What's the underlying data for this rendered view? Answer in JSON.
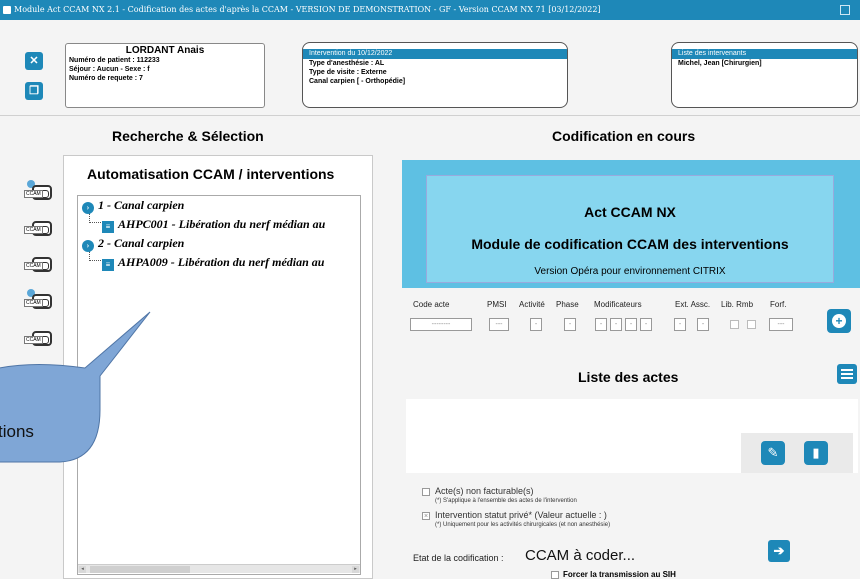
{
  "window": {
    "title": "Module Act CCAM NX 2.1 - Codification des actes d'après la CCAM - VERSION DE DEMONSTRATION - GF - Version CCAM NX 71 [03/12/2022]"
  },
  "patient": {
    "name": "LORDANT Anais",
    "patient_number": "Numéro de patient : 112233",
    "stay_sex": "Séjour : Aucun - Sexe : f",
    "request_number": "Numéro de requete : 7"
  },
  "intervention": {
    "header": "Intervention du 10/12/2022",
    "anesthesia": "Type d'anesthésie : AL",
    "visit": "Type de visite : Externe",
    "procedure": "Canal carpien [ - Orthopédie]"
  },
  "team": {
    "header": "Liste des intervenants",
    "member": "Michel, Jean [Chirurgien]"
  },
  "sections": {
    "search": "Recherche & Sélection",
    "coding": "Codification en cours",
    "automation": "Automatisation CCAM / interventions"
  },
  "side_icons": [
    {
      "name": "ccam-search-icon",
      "tag": "CCAM"
    },
    {
      "name": "ccam-folder-icon",
      "tag": "CCAM"
    },
    {
      "name": "ccam-list-icon",
      "tag": "CCAM"
    },
    {
      "name": "ccam-user-icon",
      "tag": "CCAM"
    },
    {
      "name": "ccam-team-icon",
      "tag": "CCAM"
    }
  ],
  "tree": {
    "nodes": [
      {
        "badge": "›",
        "label": "1 - Canal carpien"
      },
      {
        "badge": "≡",
        "label": "AHPC001 - Libération du nerf médian au"
      },
      {
        "badge": "›",
        "label": "2 - Canal carpien"
      },
      {
        "badge": "≡",
        "label": "AHPA009 - Libération du nerf médian au"
      }
    ]
  },
  "callout": {
    "text": "tions"
  },
  "banner": {
    "title": "Act CCAM NX",
    "subtitle": "Module de codification CCAM des interventions",
    "version": "Version Opéra pour environnement CITRIX"
  },
  "fields": {
    "code_acte": "Code acte",
    "pmsi": "PMSI",
    "activite": "Activité",
    "phase": "Phase",
    "modificateurs": "Modificateurs",
    "ext_assc": "Ext. Assc.",
    "lib_rmb": "Lib. Rmb",
    "forf": "Forf.",
    "code_placeholder": "--------",
    "pmsi_value": "---",
    "dash": "-",
    "forf_value": "---"
  },
  "list": {
    "title": "Liste des actes"
  },
  "options": {
    "non_facturable": "Acte(s) non facturable(s)",
    "non_facturable_note": "(*) S'applique à l'ensemble des actes de l'intervention",
    "statut_prive": "Intervention statut privé* (Valeur actuelle : )",
    "statut_prive_note": "(*) Uniquement pour les activités chirurgicales (et non anesthésie)",
    "etat_label": "Etat de la codification :",
    "etat_value": "CCAM à coder...",
    "force_transmission": "Forcer la transmission au SIH"
  },
  "colors": {
    "accent": "#1e88b8",
    "banner": "#5ec0e3",
    "bubble": "#7fa6d6"
  }
}
